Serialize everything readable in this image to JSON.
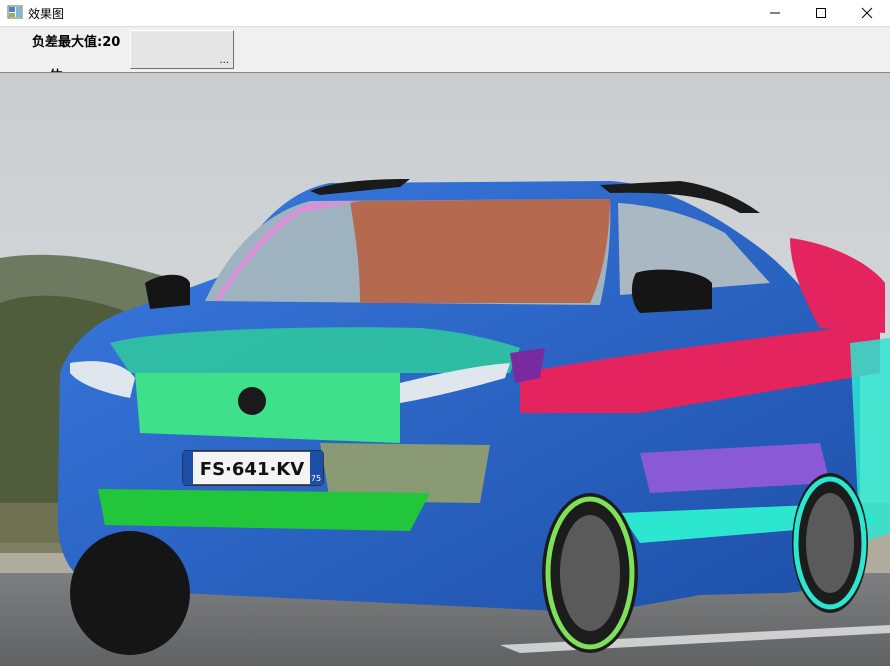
{
  "window": {
    "title": "效果图",
    "controls": [
      "minimize",
      "maximize",
      "close"
    ]
  },
  "toolbar": {
    "neg_label": "负差最大值:20",
    "second_label": "— 体……",
    "ellipsis_button": "..."
  },
  "scene": {
    "plate_text": "FS·641·KV",
    "plate_region": "75",
    "description_icons": [
      "car-image",
      "overlay-segments"
    ]
  },
  "colors": {
    "sky": "#cfd4d8",
    "car_body": "#2a62c4",
    "seg_pink": "#e3245f",
    "seg_cyan": "#2de6d0",
    "seg_green": "#22c63a",
    "seg_mint": "#3fe08a",
    "seg_orange": "#b56a4f",
    "seg_violet": "#8a5ad6"
  }
}
